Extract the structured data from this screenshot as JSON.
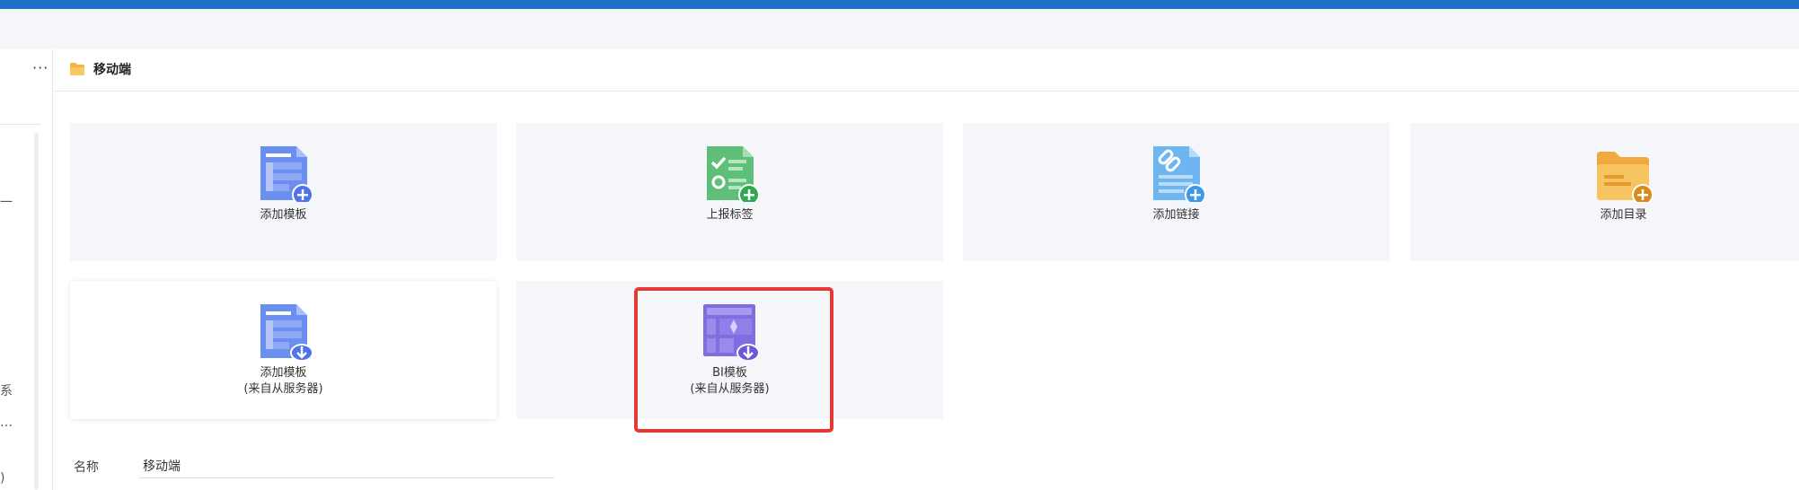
{
  "header": {
    "more_label": "···",
    "breadcrumb": "移动端"
  },
  "left_panel": {
    "fragments": [
      "一",
      "系",
      "…",
      ")"
    ]
  },
  "cards": [
    {
      "label": "添加模板",
      "icon": "template-add-icon"
    },
    {
      "label": "上报标签",
      "icon": "report-tag-icon"
    },
    {
      "label": "添加链接",
      "icon": "link-add-icon"
    },
    {
      "label": "添加目录",
      "icon": "folder-add-icon"
    },
    {
      "label_line1": "添加模板",
      "label_line2": "(来自从服务器)",
      "icon": "template-download-icon"
    },
    {
      "label_line1": "BI模板",
      "label_line2": "(来自从服务器)",
      "icon": "bi-template-download-icon"
    }
  ],
  "form": {
    "name_label": "名称",
    "name_value": "移动端"
  },
  "colors": {
    "topbar": "#1e73c8",
    "highlight": "#e53935",
    "card_bg": "#f5f6f9"
  }
}
